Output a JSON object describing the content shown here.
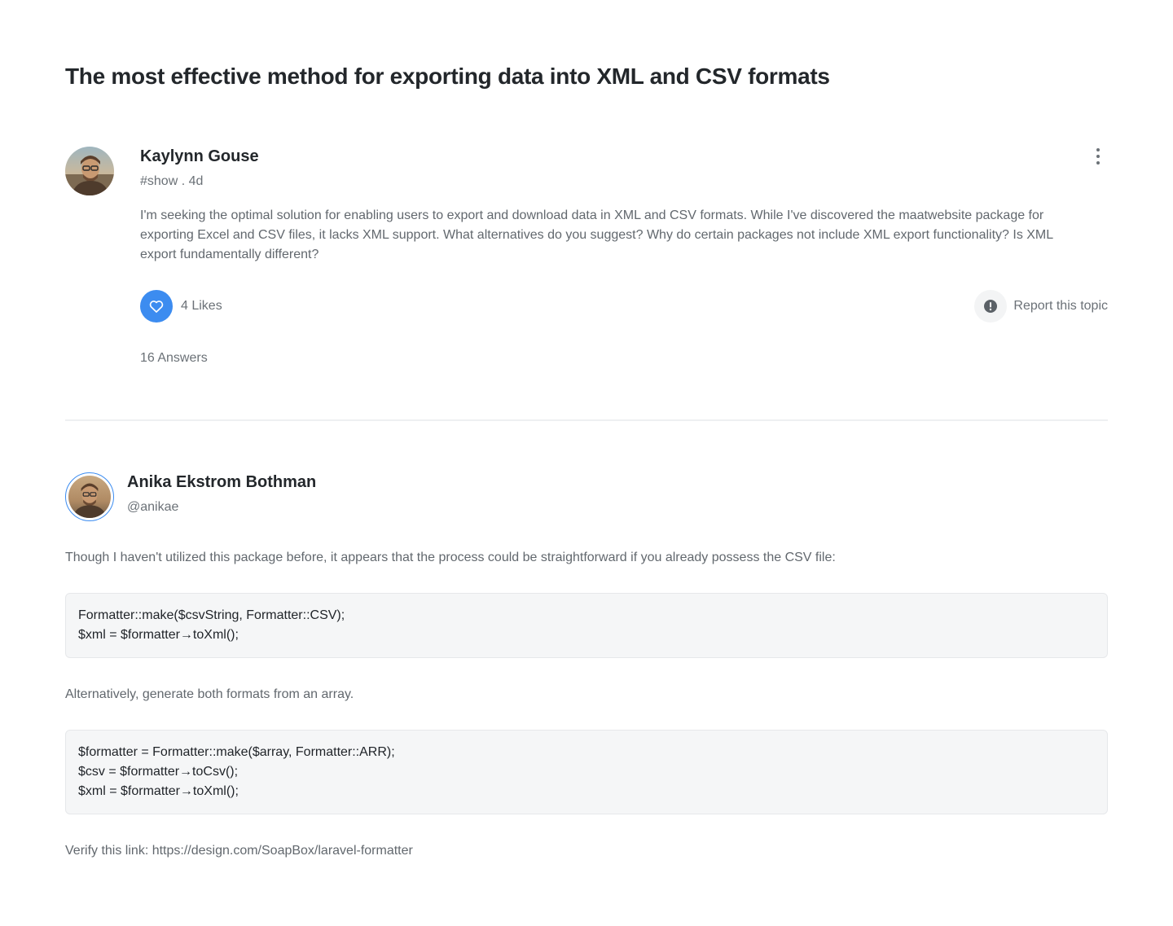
{
  "title": "The most effective method for exporting data into XML and CSV formats",
  "question": {
    "author": "Kaylynn Gouse",
    "meta": "#show . 4d",
    "body": "I'm seeking the optimal solution for enabling users to export and download data in XML and CSV formats. While I've discovered the maatwebsite package for exporting Excel and CSV files, it lacks XML support. What alternatives do you suggest? Why do certain packages not include XML export functionality? Is XML export fundamentally different?",
    "likes_label": "4 Likes",
    "report_label": "Report this topic",
    "answers_label": "16 Answers",
    "icons": {
      "more": "more-vertical-icon",
      "like": "heart-icon",
      "report": "alert-circle-icon"
    },
    "accent_color": "#3c8cf0"
  },
  "answer": {
    "author": "Anika Ekstrom Bothman",
    "handle": "@anikae",
    "intro": "Though I haven't utilized this package before, it appears that the process could be straightforward if you already possess the CSV file:",
    "code1": [
      "Formatter::make($csvString, Formatter::CSV);",
      "$xml = $formatter→toXml();"
    ],
    "middle": "Alternatively, generate both formats from an array.",
    "code2": [
      "$formatter = Formatter::make($array, Formatter::ARR);",
      "$csv = $formatter→toCsv();",
      "$xml = $formatter→toXml();"
    ],
    "verify_prefix": "Verify this link: ",
    "verify_link": "https://design.com/SoapBox/laravel-formatter"
  }
}
